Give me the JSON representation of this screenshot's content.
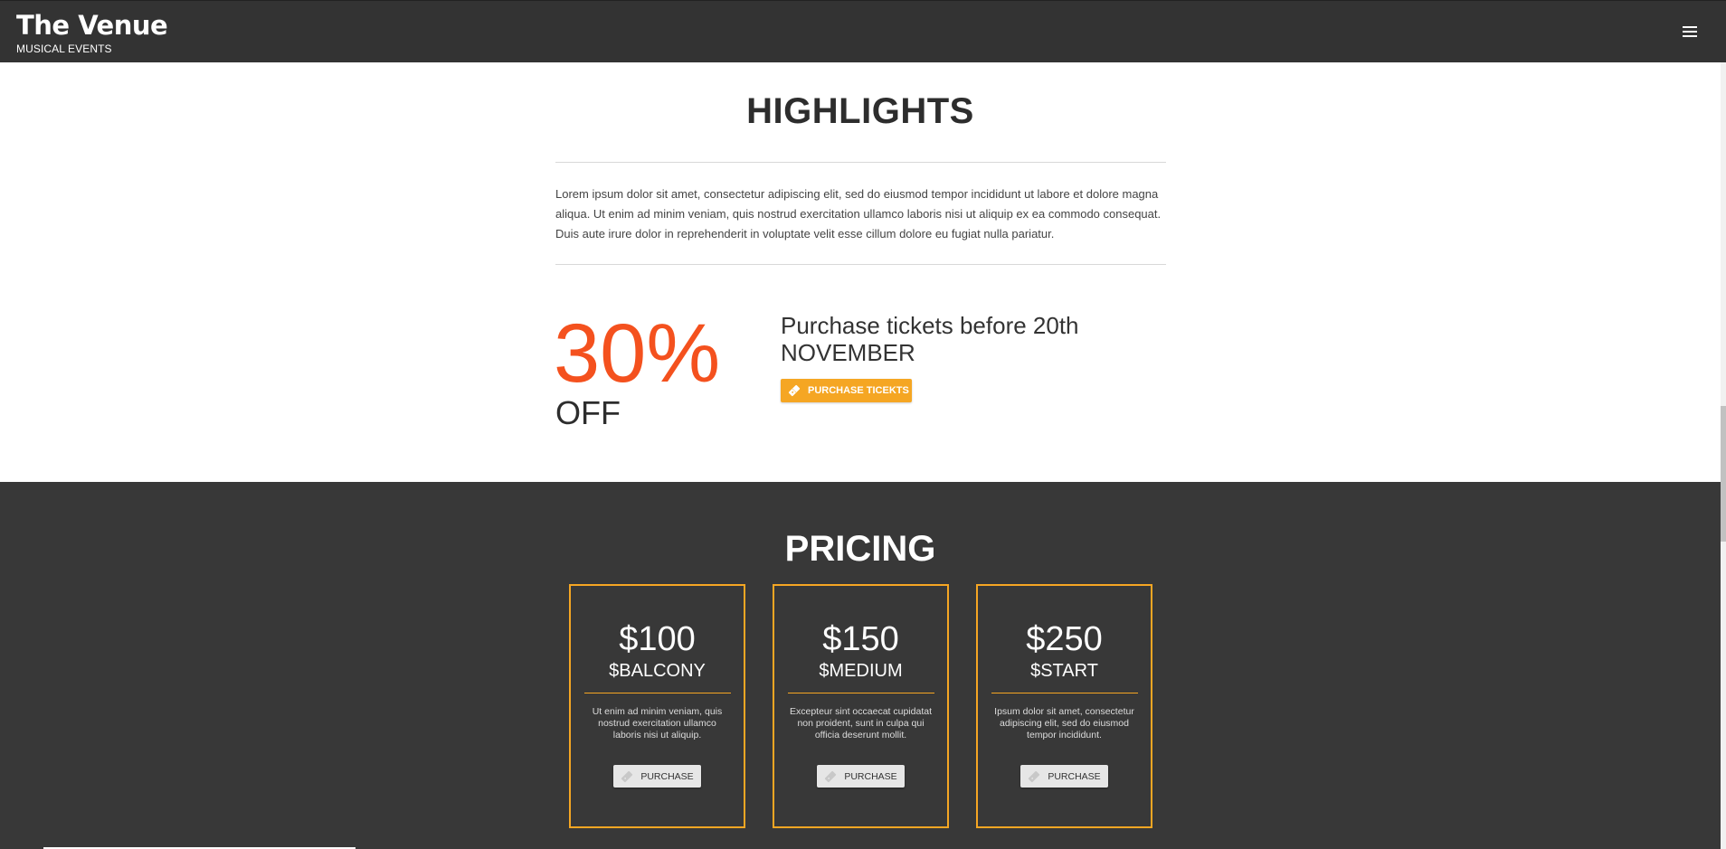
{
  "navbar": {
    "brand_title": "The Venue",
    "brand_subtitle": "MUSICAL EVENTS",
    "menu_icon": "hamburger-icon"
  },
  "highlights": {
    "title": "HIGHLIGHTS",
    "text": "Lorem ipsum dolor sit amet, consectetur adipiscing elit, sed do eiusmod tempor incididunt ut labore et dolore magna aliqua. Ut enim ad minim veniam, quis nostrud exercitation ullamco laboris nisi ut aliquip ex ea commodo consequat. Duis aute irure dolor in reprehenderit in voluptate velit esse cillum dolore eu fugiat nulla pariatur.",
    "discount_value": "30%",
    "discount_label": "OFF",
    "promo_line1": "Purchase tickets before 20th",
    "promo_line2": "NOVEMBER",
    "cta_label": "PURCHASE TICEKTS",
    "cta_icon": "ticket-icon"
  },
  "pricing": {
    "title": "PRICING",
    "plans": [
      {
        "price": "$100",
        "tier": "$BALCONY",
        "description": "Ut enim ad minim veniam, quis nostrud exercitation ullamco laboris nisi ut aliquip.",
        "button_label": "PURCHASE"
      },
      {
        "price": "$150",
        "tier": "$MEDIUM",
        "description": "Excepteur sint occaecat cupidatat non proident, sunt in culpa qui officia deserunt mollit.",
        "button_label": "PURCHASE"
      },
      {
        "price": "$250",
        "tier": "$START",
        "description": "Ipsum dolor sit amet, consectetur adipiscing elit, sed do eiusmod tempor incididunt.",
        "button_label": "PURCHASE"
      }
    ]
  },
  "colors": {
    "navbar": "#333333",
    "accent_orange": "#f4511e",
    "accent_amber": "#f5a623",
    "pricing_bg": "#383838"
  }
}
